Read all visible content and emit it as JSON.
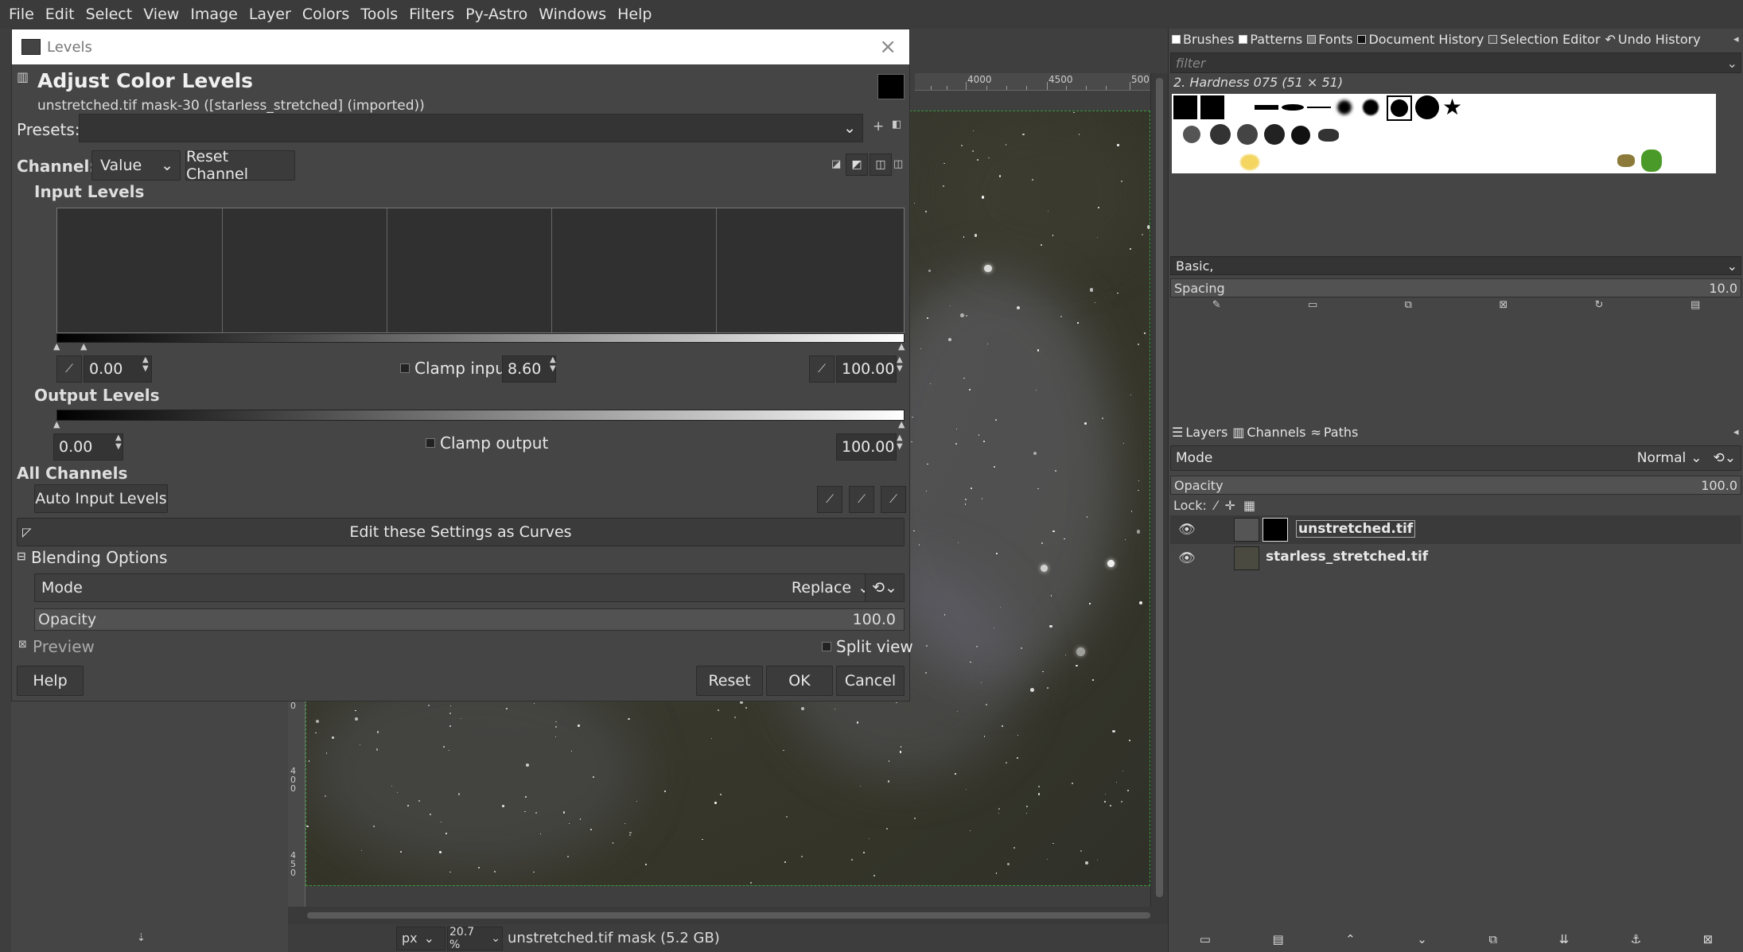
{
  "menubar": [
    "File",
    "Edit",
    "Select",
    "View",
    "Image",
    "Layer",
    "Colors",
    "Tools",
    "Filters",
    "Py-Astro",
    "Windows",
    "Help"
  ],
  "dialog": {
    "window_title": "Levels",
    "close_glyph": "×",
    "heading": "Adjust Color Levels",
    "subtitle": "unstretched.tif mask-30 ([starless_stretched] (imported))",
    "presets_label": "Presets:",
    "presets_value": "",
    "channel_label": "Channel:",
    "channel_value": "Value",
    "reset_channel": "Reset Channel",
    "input_levels": "Input Levels",
    "input_low": "0.00",
    "clamp_input": "Clamp input",
    "gamma": "8.60",
    "input_high": "100.00",
    "output_levels": "Output Levels",
    "output_low": "0.00",
    "clamp_output": "Clamp output",
    "output_high": "100.00",
    "all_channels": "All Channels",
    "auto_input": "Auto Input Levels",
    "edit_curves": "Edit these Settings as Curves",
    "blending_options": "Blending Options",
    "mode_label": "Mode",
    "mode_value": "Replace",
    "opacity_label": "Opacity",
    "opacity_value": "100.0",
    "preview": "Preview",
    "split_view": "Split view",
    "help": "Help",
    "reset": "Reset",
    "ok": "OK",
    "cancel": "Cancel"
  },
  "ruler": {
    "h_labels": [
      "4000",
      "4500",
      "500"
    ],
    "v_labels": [
      "0",
      "4\n0\n0",
      "4\n5\n0"
    ]
  },
  "status": {
    "unit": "px",
    "zoom": "20.7 %",
    "info": "unstretched.tif mask (5.2 GB)"
  },
  "right": {
    "tabs_top": [
      "Brushes",
      "Patterns",
      "Fonts",
      "Document History",
      "Selection Editor",
      "Undo History"
    ],
    "filter_placeholder": "filter",
    "brush_name": "2. Hardness 075 (51 × 51)",
    "brush_tag": "Basic,",
    "spacing_label": "Spacing",
    "spacing_value": "10.0",
    "tabs_layers": [
      "Layers",
      "Channels",
      "Paths"
    ],
    "mode_label": "Mode",
    "mode_value": "Normal",
    "opacity_label": "Opacity",
    "opacity_value": "100.0",
    "lock_label": "Lock:",
    "layers": [
      "unstretched.tif",
      "starless_stretched.tif"
    ]
  },
  "colors": {
    "accent": "#3c9a3c",
    "panel": "#454545",
    "field": "#343434"
  }
}
